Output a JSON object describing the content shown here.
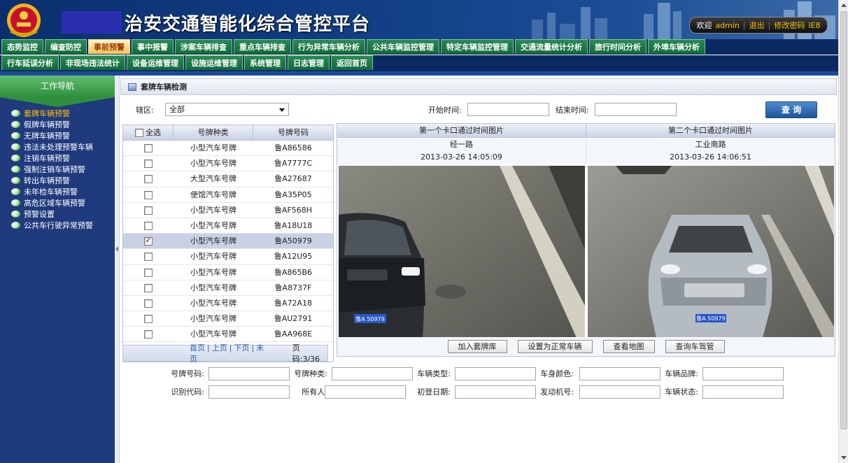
{
  "header": {
    "app_title": "治安交通智能化综合管控平台",
    "user": {
      "welcome": "欢迎",
      "username": "admin",
      "logout": "退出",
      "change_password": "修改密码",
      "browser": "IE8"
    }
  },
  "nav_row1": [
    {
      "label": "态势监控",
      "active": false
    },
    {
      "label": "编查防控",
      "active": false
    },
    {
      "label": "事前预警",
      "active": true
    },
    {
      "label": "事中报警",
      "active": false
    },
    {
      "label": "涉案车辆排查",
      "active": false
    },
    {
      "label": "重点车辆排查",
      "active": false
    },
    {
      "label": "行为异常车辆分析",
      "active": false
    },
    {
      "label": "公共车辆监控管理",
      "active": false
    },
    {
      "label": "特定车辆监控管理",
      "active": false
    },
    {
      "label": "交通流量统计分析",
      "active": false
    },
    {
      "label": "旅行时间分析",
      "active": false
    },
    {
      "label": "外埠车辆分析",
      "active": false
    }
  ],
  "nav_row2": [
    {
      "label": "行车延误分析"
    },
    {
      "label": "非现场违法统计"
    },
    {
      "label": "设备运维管理"
    },
    {
      "label": "设施运维管理"
    },
    {
      "label": "系统管理"
    },
    {
      "label": "日志管理"
    },
    {
      "label": "返回首页"
    }
  ],
  "sidebar": {
    "title": "工作导航",
    "items": [
      {
        "label": "套牌车辆预警",
        "active": true
      },
      {
        "label": "假牌车辆预警",
        "active": false
      },
      {
        "label": "无牌车辆预警",
        "active": false
      },
      {
        "label": "违法未处理预警车辆",
        "active": false
      },
      {
        "label": "注销车辆预警",
        "active": false
      },
      {
        "label": "强制注销车辆预警",
        "active": false
      },
      {
        "label": "转出车辆预警",
        "active": false
      },
      {
        "label": "未年检车辆预警",
        "active": false
      },
      {
        "label": "高危区域车辆预警",
        "active": false
      },
      {
        "label": "预警设置",
        "active": false
      },
      {
        "label": "公共车行驶异常预警",
        "active": false
      }
    ]
  },
  "page": {
    "breadcrumb": "套牌车辆检测",
    "filters": {
      "area_label": "辖区:",
      "area_value": "全部",
      "start_label": "开始时间:",
      "start_value": "",
      "end_label": "结束时间:",
      "end_value": ""
    },
    "query_button": "查 询"
  },
  "plate_table": {
    "headers": {
      "select_all": "全选",
      "type": "号牌种类",
      "number": "号牌号码"
    },
    "rows": [
      {
        "type": "小型汽车号牌",
        "number": "鲁A86586",
        "checked": false
      },
      {
        "type": "小型汽车号牌",
        "number": "鲁A7777C",
        "checked": false
      },
      {
        "type": "大型汽车号牌",
        "number": "鲁A27687",
        "checked": false
      },
      {
        "type": "使馆汽车号牌",
        "number": "鲁A35P05",
        "checked": false
      },
      {
        "type": "小型汽车号牌",
        "number": "鲁AF568H",
        "checked": false
      },
      {
        "type": "小型汽车号牌",
        "number": "鲁A18U18",
        "checked": false
      },
      {
        "type": "小型汽车号牌",
        "number": "鲁A50979",
        "checked": true
      },
      {
        "type": "小型汽车号牌",
        "number": "鲁A12U95",
        "checked": false
      },
      {
        "type": "小型汽车号牌",
        "number": "鲁A865B6",
        "checked": false
      },
      {
        "type": "小型汽车号牌",
        "number": "鲁A8737F",
        "checked": false
      },
      {
        "type": "小型汽车号牌",
        "number": "鲁A72A18",
        "checked": false
      },
      {
        "type": "小型汽车号牌",
        "number": "鲁AU2791",
        "checked": false
      },
      {
        "type": "小型汽车号牌",
        "number": "鲁AA968E",
        "checked": false
      }
    ],
    "pager": {
      "first": "首页",
      "prev": "上页",
      "next": "下页",
      "last": "末页",
      "page_info": "页码:3/36"
    }
  },
  "photos": {
    "first": {
      "header": "第一个卡口通过时间图片",
      "location": "经一路",
      "time": "2013-03-26 14:05:09",
      "plate": "鲁A 50979"
    },
    "second": {
      "header": "第二个卡口通过时间图片",
      "location": "工业南路",
      "time": "2013-03-26 14:06:51",
      "plate": "鲁A 50979"
    },
    "actions": [
      "加入套牌库",
      "设置为正常车辆",
      "查看地图",
      "查询车驾管"
    ]
  },
  "details": {
    "row1": [
      {
        "label": "号牌号码:",
        "value": ""
      },
      {
        "label": "号牌种类:",
        "value": ""
      },
      {
        "label": "车辆类型:",
        "value": ""
      },
      {
        "label": "车身颜色:",
        "value": ""
      },
      {
        "label": "车辆品牌:",
        "value": ""
      }
    ],
    "row2": [
      {
        "label": "识别代码:",
        "value": ""
      },
      {
        "label": "所有人:",
        "value": ""
      },
      {
        "label": "初登日期:",
        "value": ""
      },
      {
        "label": "发动机号:",
        "value": ""
      },
      {
        "label": "车辆状态:",
        "value": ""
      }
    ]
  },
  "colors": {
    "header_bg": "#0b2f6e",
    "tab_green": "#116a36",
    "tab_active": "#f6c357",
    "sidebar_bg": "#1f3a7d",
    "accent_link": "#2a5db0"
  }
}
